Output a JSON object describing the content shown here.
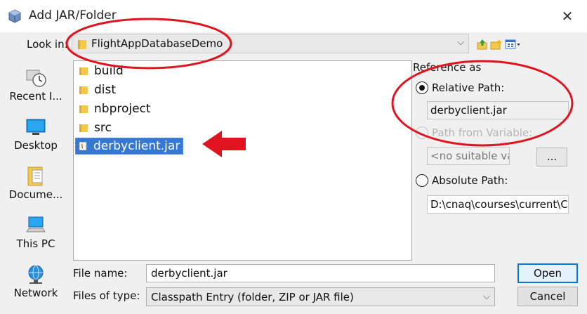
{
  "window": {
    "title": "Add JAR/Folder",
    "close_glyph": "✕"
  },
  "lookin": {
    "label": "Look in:",
    "value": "FlightAppDatabaseDemo",
    "chevron": "⌵"
  },
  "toolbar": {
    "icons": [
      "up-folder-icon",
      "new-folder-icon",
      "view-menu-icon"
    ]
  },
  "places": [
    {
      "name": "recent",
      "label": "Recent I...",
      "icon": "clock-icon"
    },
    {
      "name": "desktop",
      "label": "Desktop",
      "icon": "desktop-icon"
    },
    {
      "name": "documents",
      "label": "Docume...",
      "icon": "documents-icon"
    },
    {
      "name": "thispc",
      "label": "This PC",
      "icon": "computer-icon"
    },
    {
      "name": "network",
      "label": "Network",
      "icon": "network-icon"
    }
  ],
  "files": [
    {
      "name": "build",
      "type": "folder"
    },
    {
      "name": "dist",
      "type": "folder"
    },
    {
      "name": "nbproject",
      "type": "folder"
    },
    {
      "name": "src",
      "type": "folder"
    },
    {
      "name": "derbyclient.jar",
      "type": "jar",
      "selected": true
    }
  ],
  "reference": {
    "title": "Reference as",
    "relative": {
      "label": "Relative Path:",
      "value": "derbyclient.jar",
      "checked": true
    },
    "variable": {
      "label": "Path from Variable:",
      "value": "<no suitable var",
      "button": "...",
      "enabled": false
    },
    "absolute": {
      "label": "Absolute Path:",
      "value": "D:\\cnaq\\courses\\current\\CP",
      "checked": false
    }
  },
  "filename": {
    "label": "File name:",
    "value": "derbyclient.jar"
  },
  "filetype": {
    "label": "Files of type:",
    "value": "Classpath Entry (folder, ZIP or JAR file)",
    "chevron": "⌵"
  },
  "buttons": {
    "open": "Open",
    "cancel": "Cancel"
  },
  "colors": {
    "selection": "#3478d4",
    "annotation": "#e0141e",
    "folder": "#f2c94c"
  }
}
